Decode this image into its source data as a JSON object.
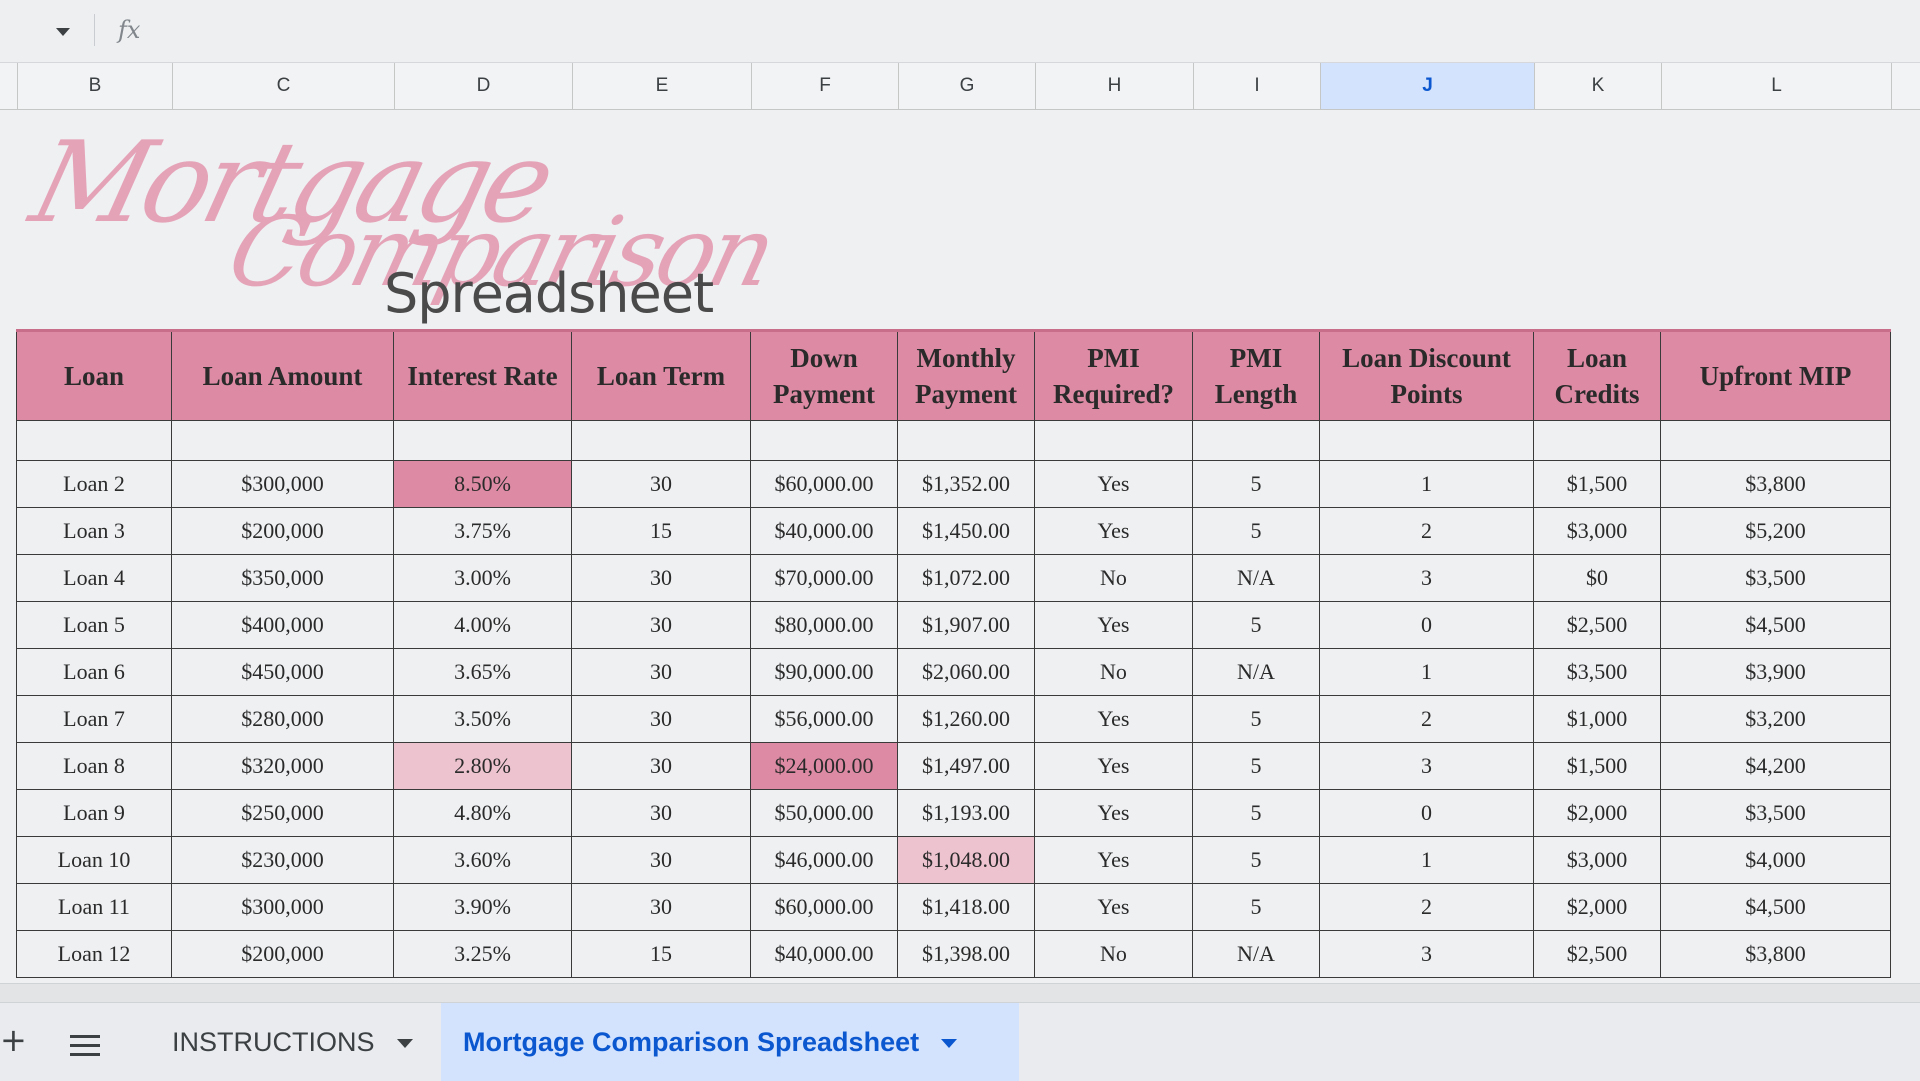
{
  "formula_bar": {
    "fx_label": "fx"
  },
  "columns": [
    "B",
    "C",
    "D",
    "E",
    "F",
    "G",
    "H",
    "I",
    "J",
    "K",
    "L"
  ],
  "active_column": "J",
  "title": {
    "line1": "Mortgage",
    "line2": "Comparison",
    "line3": "Spreadsheet"
  },
  "table": {
    "headers": [
      "Loan",
      "Loan Amount",
      "Interest Rate",
      "Loan Term",
      "Down Payment",
      "Monthly Payment",
      "PMI Required?",
      "PMI Length",
      "Loan Discount Points",
      "Loan Credits",
      "Upfront MIP"
    ],
    "rows": [
      [
        "Loan 2",
        "$300,000",
        "8.50%",
        "30",
        "$60,000.00",
        "$1,352.00",
        "Yes",
        "5",
        "1",
        "$1,500",
        "$3,800"
      ],
      [
        "Loan 3",
        "$200,000",
        "3.75%",
        "15",
        "$40,000.00",
        "$1,450.00",
        "Yes",
        "5",
        "2",
        "$3,000",
        "$5,200"
      ],
      [
        "Loan 4",
        "$350,000",
        "3.00%",
        "30",
        "$70,000.00",
        "$1,072.00",
        "No",
        "N/A",
        "3",
        "$0",
        "$3,500"
      ],
      [
        "Loan 5",
        "$400,000",
        "4.00%",
        "30",
        "$80,000.00",
        "$1,907.00",
        "Yes",
        "5",
        "0",
        "$2,500",
        "$4,500"
      ],
      [
        "Loan 6",
        "$450,000",
        "3.65%",
        "30",
        "$90,000.00",
        "$2,060.00",
        "No",
        "N/A",
        "1",
        "$3,500",
        "$3,900"
      ],
      [
        "Loan 7",
        "$280,000",
        "3.50%",
        "30",
        "$56,000.00",
        "$1,260.00",
        "Yes",
        "5",
        "2",
        "$1,000",
        "$3,200"
      ],
      [
        "Loan 8",
        "$320,000",
        "2.80%",
        "30",
        "$24,000.00",
        "$1,497.00",
        "Yes",
        "5",
        "3",
        "$1,500",
        "$4,200"
      ],
      [
        "Loan 9",
        "$250,000",
        "4.80%",
        "30",
        "$50,000.00",
        "$1,193.00",
        "Yes",
        "5",
        "0",
        "$2,000",
        "$3,500"
      ],
      [
        "Loan 10",
        "$230,000",
        "3.60%",
        "30",
        "$46,000.00",
        "$1,048.00",
        "Yes",
        "5",
        "1",
        "$3,000",
        "$4,000"
      ],
      [
        "Loan 11",
        "$300,000",
        "3.90%",
        "30",
        "$60,000.00",
        "$1,418.00",
        "Yes",
        "5",
        "2",
        "$2,000",
        "$4,500"
      ],
      [
        "Loan 12",
        "$200,000",
        "3.25%",
        "15",
        "$40,000.00",
        "$1,398.00",
        "No",
        "N/A",
        "3",
        "$2,500",
        "$3,800"
      ]
    ]
  },
  "tabs": {
    "add_label": "+",
    "items": [
      {
        "label": "INSTRUCTIONS"
      },
      {
        "label": "Mortgage Comparison Spreadsheet"
      }
    ]
  },
  "colors": {
    "header_pink": "#dd8aa4",
    "soft_pink": "#ecc3cf",
    "active_blue": "#0b57d0"
  }
}
